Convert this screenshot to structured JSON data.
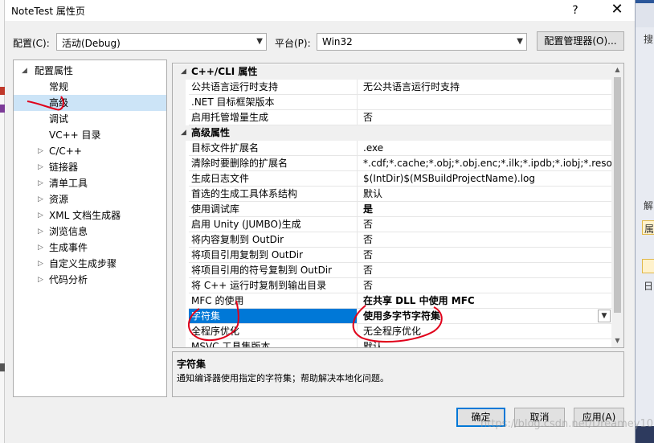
{
  "dialog": {
    "title": "NoteTest 属性页",
    "help": "?",
    "close": "✕"
  },
  "config": {
    "label": "配置(C):",
    "value": "活动(Debug)",
    "platform_label": "平台(P):",
    "platform_value": "Win32",
    "manager_button": "配置管理器(O)..."
  },
  "tree": {
    "root": "配置属性",
    "items": [
      {
        "label": "常规"
      },
      {
        "label": "高级"
      },
      {
        "label": "调试"
      },
      {
        "label": "VC++ 目录"
      },
      {
        "label": "C/C++"
      },
      {
        "label": "链接器"
      },
      {
        "label": "清单工具"
      },
      {
        "label": "资源"
      },
      {
        "label": "XML 文档生成器"
      },
      {
        "label": "浏览信息"
      },
      {
        "label": "生成事件"
      },
      {
        "label": "自定义生成步骤"
      },
      {
        "label": "代码分析"
      }
    ]
  },
  "grid": {
    "cat1": "C++/CLI 属性",
    "cat1_rows": [
      {
        "name": "公共语言运行时支持",
        "value": "无公共语言运行时支持"
      },
      {
        "name": ".NET 目标框架版本",
        "value": ""
      },
      {
        "name": "启用托管增量生成",
        "value": "否"
      }
    ],
    "cat2": "高级属性",
    "cat2_rows": [
      {
        "name": "目标文件扩展名",
        "value": ".exe"
      },
      {
        "name": "清除时要删除的扩展名",
        "value": "*.cdf;*.cache;*.obj;*.obj.enc;*.ilk;*.ipdb;*.iobj;*.resources;*.tlb;"
      },
      {
        "name": "生成日志文件",
        "value": "$(IntDir)$(MSBuildProjectName).log"
      },
      {
        "name": "首选的生成工具体系结构",
        "value": "默认"
      },
      {
        "name": "使用调试库",
        "value": "是"
      },
      {
        "name": "启用 Unity (JUMBO)生成",
        "value": "否"
      },
      {
        "name": "将内容复制到 OutDir",
        "value": "否"
      },
      {
        "name": "将项目引用复制到 OutDir",
        "value": "否"
      },
      {
        "name": "将项目引用的符号复制到 OutDir",
        "value": "否"
      },
      {
        "name": "将 C++ 运行时复制到输出目录",
        "value": "否"
      },
      {
        "name": "MFC 的使用",
        "value": "在共享 DLL 中使用 MFC"
      },
      {
        "name": "字符集",
        "value": "使用多字节字符集"
      },
      {
        "name": "全程序优化",
        "value": "无全程序优化"
      },
      {
        "name": "MSVC 工具集版本",
        "value": "默认"
      }
    ]
  },
  "description": {
    "title": "字符集",
    "text": "通知编译器使用指定的字符集；帮助解决本地化问题。"
  },
  "buttons": {
    "ok": "确定",
    "cancel": "取消",
    "apply": "应用(A)"
  },
  "watermark": "https://blog.csdn.net/Dreamey1017",
  "background": {
    "strip_texts": [
      "搜",
      "解",
      "属",
      "日"
    ]
  }
}
